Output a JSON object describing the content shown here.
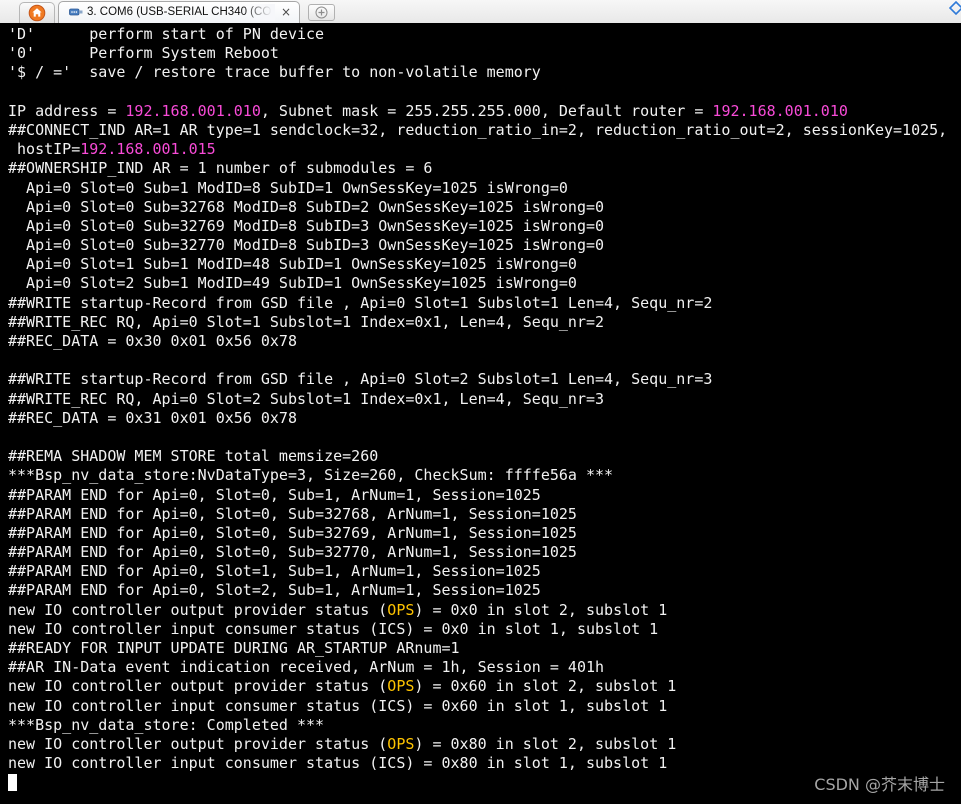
{
  "window": {
    "home_tab": {
      "icon": "home-icon"
    },
    "session_tab": {
      "label": "3. COM6 (USB-SERIAL CH340 (CO",
      "icon": "serial-port-icon",
      "close_label": "×"
    },
    "new_tab": {
      "icon": "plus-circle-icon"
    },
    "tab_list": {
      "icon": "tab-list-icon"
    }
  },
  "colors": {
    "terminal_bg": "#000000",
    "terminal_fg": "#f2f2f2",
    "ip": "#f94bd8",
    "ops": "#ffc400",
    "cursor": "#ffffff",
    "watermark": "#a6a6a6",
    "home_icon": "#f07a22"
  },
  "terminal": {
    "lines": [
      [
        "'D'      perform start of PN device"
      ],
      [
        "'0'      Perform System Reboot"
      ],
      [
        "'$ / ='  save / restore trace buffer to non-volatile memory"
      ],
      [],
      [
        "IP address = ",
        {
          "t": "192.168.001.010",
          "hl": "ip"
        },
        ", Subnet mask = 255.255.255.000, Default router = ",
        {
          "t": "192.168.001.010",
          "hl": "ip"
        }
      ],
      [
        "##CONNECT_IND AR=1 AR type=1 sendclock=32, reduction_ratio_in=2, reduction_ratio_out=2, sessionKey=1025,"
      ],
      [
        " hostIP=",
        {
          "t": "192.168.001.015",
          "hl": "ip"
        }
      ],
      [
        "##OWNERSHIP_IND AR = 1 number of submodules = 6"
      ],
      [
        "  Api=0 Slot=0 Sub=1 ModID=8 SubID=1 OwnSessKey=1025 isWrong=0"
      ],
      [
        "  Api=0 Slot=0 Sub=32768 ModID=8 SubID=2 OwnSessKey=1025 isWrong=0"
      ],
      [
        "  Api=0 Slot=0 Sub=32769 ModID=8 SubID=3 OwnSessKey=1025 isWrong=0"
      ],
      [
        "  Api=0 Slot=0 Sub=32770 ModID=8 SubID=3 OwnSessKey=1025 isWrong=0"
      ],
      [
        "  Api=0 Slot=1 Sub=1 ModID=48 SubID=1 OwnSessKey=1025 isWrong=0"
      ],
      [
        "  Api=0 Slot=2 Sub=1 ModID=49 SubID=1 OwnSessKey=1025 isWrong=0"
      ],
      [
        "##WRITE startup-Record from GSD file , Api=0 Slot=1 Subslot=1 Len=4, Sequ_nr=2"
      ],
      [
        "##WRITE_REC RQ, Api=0 Slot=1 Subslot=1 Index=0x1, Len=4, Sequ_nr=2"
      ],
      [
        "##REC_DATA = 0x30 0x01 0x56 0x78"
      ],
      [],
      [
        "##WRITE startup-Record from GSD file , Api=0 Slot=2 Subslot=1 Len=4, Sequ_nr=3"
      ],
      [
        "##WRITE_REC RQ, Api=0 Slot=2 Subslot=1 Index=0x1, Len=4, Sequ_nr=3"
      ],
      [
        "##REC_DATA = 0x31 0x01 0x56 0x78"
      ],
      [],
      [
        "##REMA SHADOW MEM STORE total memsize=260"
      ],
      [
        "***Bsp_nv_data_store:NvDataType=3, Size=260, CheckSum: ffffe56a ***"
      ],
      [
        "##PARAM END for Api=0, Slot=0, Sub=1, ArNum=1, Session=1025"
      ],
      [
        "##PARAM END for Api=0, Slot=0, Sub=32768, ArNum=1, Session=1025"
      ],
      [
        "##PARAM END for Api=0, Slot=0, Sub=32769, ArNum=1, Session=1025"
      ],
      [
        "##PARAM END for Api=0, Slot=0, Sub=32770, ArNum=1, Session=1025"
      ],
      [
        "##PARAM END for Api=0, Slot=1, Sub=1, ArNum=1, Session=1025"
      ],
      [
        "##PARAM END for Api=0, Slot=2, Sub=1, ArNum=1, Session=1025"
      ],
      [
        "new IO controller output provider status (",
        {
          "t": "OPS",
          "hl": "ops"
        },
        ") = 0x0 in slot 2, subslot 1"
      ],
      [
        "new IO controller input consumer status (ICS) = 0x0 in slot 1, subslot 1"
      ],
      [
        "##READY FOR INPUT UPDATE DURING AR_STARTUP ARnum=1"
      ],
      [
        "##AR IN-Data event indication received, ArNum = 1h, Session = 401h"
      ],
      [
        "new IO controller output provider status (",
        {
          "t": "OPS",
          "hl": "ops"
        },
        ") = 0x60 in slot 2, subslot 1"
      ],
      [
        "new IO controller input consumer status (ICS) = 0x60 in slot 1, subslot 1"
      ],
      [
        "***Bsp_nv_data_store: Completed ***"
      ],
      [
        "new IO controller output provider status (",
        {
          "t": "OPS",
          "hl": "ops"
        },
        ") = 0x80 in slot 2, subslot 1"
      ],
      [
        "new IO controller input consumer status (ICS) = 0x80 in slot 1, subslot 1"
      ]
    ]
  },
  "watermark": "CSDN @芥末博士"
}
